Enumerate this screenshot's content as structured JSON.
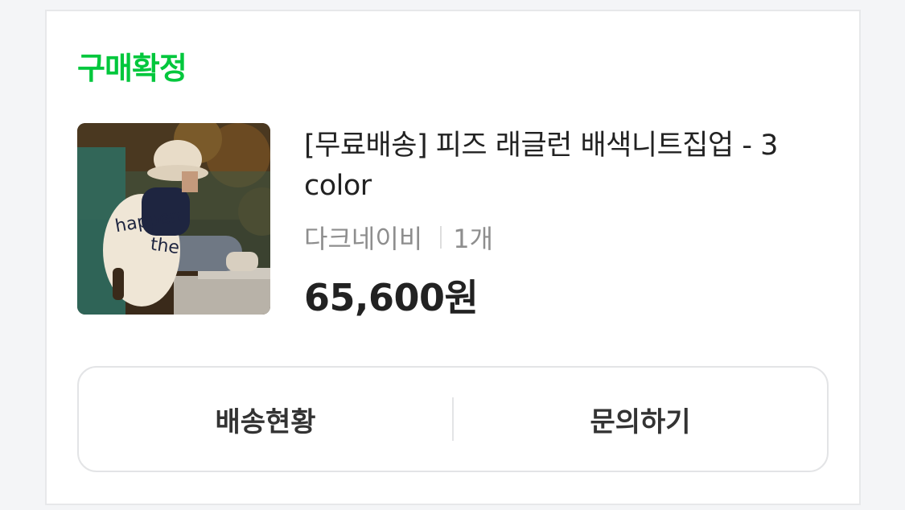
{
  "order": {
    "status_label": "구매확정",
    "status_color": "#00c73c"
  },
  "product": {
    "thumbnail_alt": "product photo: child in cream knit jacket and bucket hat",
    "title": "[무료배송] 피즈 래글런 배색니트집업 - 3 color",
    "option": "다크네이비",
    "quantity": "1개",
    "price": "65,600원"
  },
  "actions": {
    "delivery_status": "배송현황",
    "inquiry": "문의하기"
  }
}
